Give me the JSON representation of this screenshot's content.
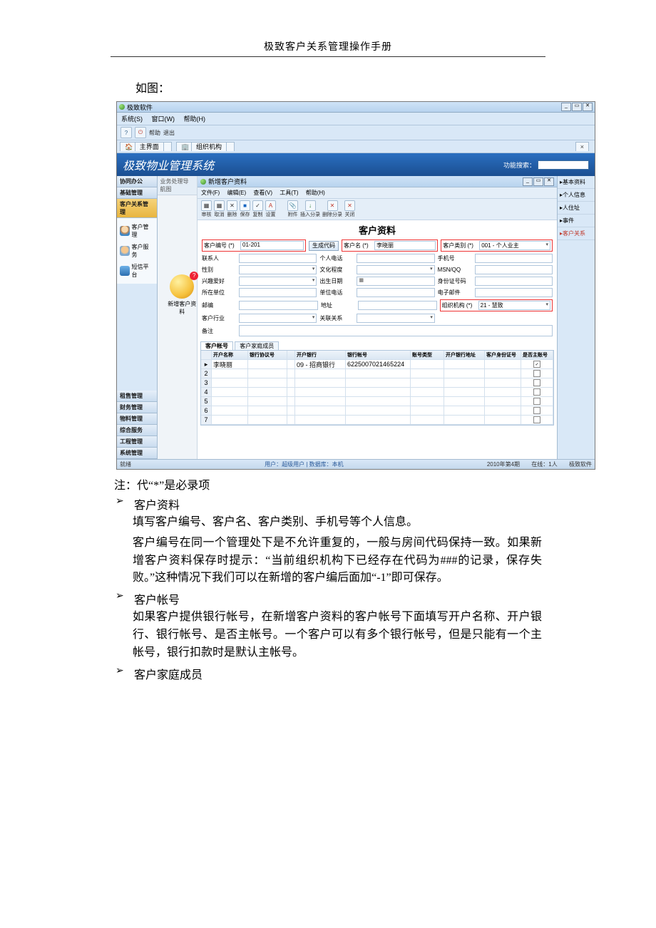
{
  "doc": {
    "header": "极致客户关系管理操作手册",
    "intro": "如图：",
    "note": "注：代“*”是必录项",
    "sections": [
      {
        "title": "客户资料",
        "paras": [
          "填写客户编号、客户名、客户类别、手机号等个人信息。",
          "客户编号在同一个管理处下是不允许重复的，一般与房间代码保持一致。如果新增客户资料保存时提示：“当前组织机构下已经存在代码为###的记录，保存失败。”这种情况下我们可以在新增的客户编后面加“-1”即可保存。"
        ]
      },
      {
        "title": "客户帐号",
        "paras": [
          "如果客户提供银行帐号，在新增客户资料的客户帐号下面填写开户名称、开户银行、银行帐号、是否主帐号。一个客户可以有多个银行帐号，但是只能有一个主帐号，银行扣款时是默认主帐号。"
        ]
      },
      {
        "title": "客户家庭成员",
        "paras": []
      }
    ]
  },
  "shot": {
    "app_title": "极致软件",
    "menubar": [
      "系统(S)",
      "窗口(W)",
      "帮助(H)"
    ],
    "toolbar_labels": [
      "帮助",
      "退出"
    ],
    "tabs": [
      "主界面",
      "组织机构"
    ],
    "banner_title": "极致物业管理系统",
    "banner_search_label": "功能搜索：",
    "left_sections": [
      "协同办公",
      "基础管理",
      "客户关系管理"
    ],
    "left_items": [
      "客户管理",
      "客户服务",
      "短信平台"
    ],
    "left_bottom_sections": [
      "租售管理",
      "财务管理",
      "物料管理",
      "综合服务",
      "工程管理",
      "系统管理"
    ],
    "mid_head": "业务处理导航图",
    "mid_icon_label": "新增客户资料",
    "sub_title": "新增客户资料",
    "sub_menu": [
      "文件(F)",
      "编辑(E)",
      "查看(V)",
      "工具(T)",
      "帮助(H)"
    ],
    "sub_toolbar": [
      {
        "ic": "▦",
        "l": "审核"
      },
      {
        "ic": "▦",
        "l": "取消"
      },
      {
        "ic": "✕",
        "l": "删除"
      },
      {
        "ic": "■",
        "l": "保存"
      },
      {
        "ic": "✓",
        "l": "复制"
      },
      {
        "ic": "A",
        "l": "设置"
      },
      {
        "ic": "📎",
        "l": "附件"
      },
      {
        "ic": "↓",
        "l": "插入分录"
      },
      {
        "ic": "✕",
        "l": "删除分录"
      },
      {
        "ic": "✕",
        "l": "关闭"
      }
    ],
    "form_title": "客户资料",
    "fields": {
      "code_lbl": "客户编号 (*)",
      "code_val": "01-201",
      "gen_btn": "生成代码",
      "name_lbl": "客户名 (*)",
      "name_val": "李晓丽",
      "type_lbl": "客户类别 (*)",
      "type_val": "001 - 个人业主",
      "contact_lbl": "联系人",
      "tel_lbl": "个人电话",
      "mobile_lbl": "手机号",
      "sex_lbl": "性别",
      "edu_lbl": "文化程度",
      "msn_lbl": "MSN/QQ",
      "hobby_lbl": "兴趣爱好",
      "birth_lbl": "出生日期",
      "idcard_lbl": "身份证号码",
      "company_lbl": "所在单位",
      "ctel_lbl": "单位电话",
      "email_lbl": "电子邮件",
      "zip_lbl": "邮编",
      "addr_lbl": "地址",
      "org_lbl": "组织机构 (*)",
      "org_val": "21 - 慧致",
      "industry_lbl": "客户行业",
      "related_lbl": "关联关系",
      "remark_lbl": "备注"
    },
    "subtabs": [
      "客户帐号",
      "客户家庭成员"
    ],
    "grid_head": [
      "开户名称",
      "银行协议号",
      "",
      "开户银行",
      "银行帐号",
      "账号类型",
      "开户银行地址",
      "客户身份证号",
      "是否主账号"
    ],
    "grid_row1": {
      "name": "李晓丽",
      "bank": "09 - 招商银行",
      "acct": "6225007021465224",
      "main": true
    },
    "right_items": [
      "基本资料",
      "个人信息",
      "人住址",
      "事件",
      "客户关系"
    ],
    "status_left": "就绪",
    "status_mid": "用户：超级用户 | 数据库：本机",
    "status_period": "2010年第4期",
    "status_online": "在线：1人",
    "status_brand": "极致软件"
  }
}
